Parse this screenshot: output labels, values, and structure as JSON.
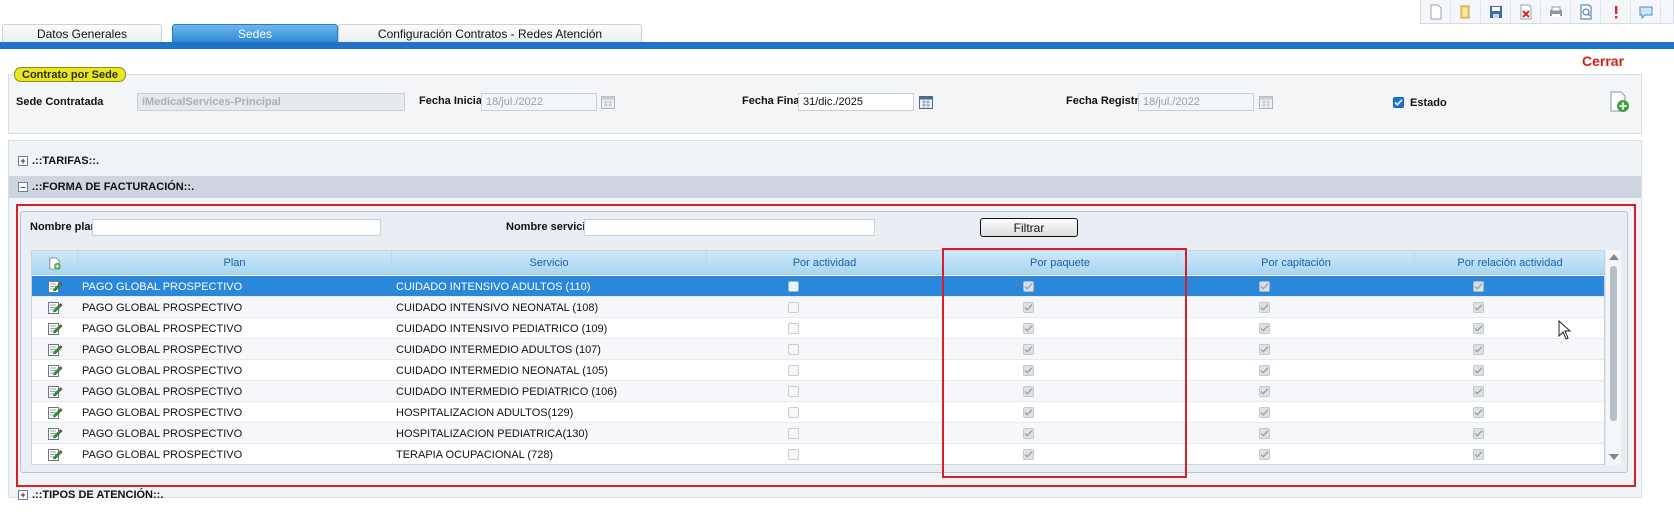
{
  "toolbar": {
    "icons": [
      "new-document-icon",
      "open-folder-icon",
      "save-icon",
      "delete-icon",
      "print-icon",
      "search-document-icon",
      "alert-icon",
      "chat-icon"
    ]
  },
  "tabs": [
    {
      "label": "Datos Generales",
      "active": false
    },
    {
      "label": "Sedes",
      "active": true
    },
    {
      "label": "Configuración Contratos - Redes Atención",
      "active": false
    }
  ],
  "cerrar": "Cerrar",
  "contrato": {
    "badge": "Contrato por Sede",
    "sede_label": "Sede Contratada",
    "sede_value": "iMedicalServices-Principal",
    "fecha_inicial_label": "Fecha Inicial",
    "fecha_inicial_value": "18/jul./2022",
    "fecha_final_label": "Fecha Final",
    "fecha_final_value": "31/dic./2025",
    "fecha_registro_label": "Fecha Registro",
    "fecha_registro_value": "18/jul./2022",
    "estado_label": "Estado",
    "estado_checked": true
  },
  "sections": {
    "tarifas": ".::TARIFAS::.",
    "forma_facturacion": ".::FORMA DE FACTURACIÓN::.",
    "tipos_atencion": ".::TIPOS DE ATENCIÓN::."
  },
  "filters": {
    "nombre_plan_label": "Nombre plan",
    "nombre_plan_value": "",
    "nombre_servicio_label": "Nombre servicio",
    "nombre_servicio_value": "",
    "filtrar_label": "Filtrar"
  },
  "grid": {
    "columns": [
      "Plan",
      "Servicio",
      "Por actividad",
      "Por paquete",
      "Por capitación",
      "Por relación actividad"
    ],
    "rows": [
      {
        "plan": "PAGO GLOBAL PROSPECTIVO",
        "servicio": "CUIDADO INTENSIVO ADULTOS (110)",
        "por_actividad": false,
        "por_paquete": true,
        "por_capitacion": true,
        "por_relacion": true,
        "selected": true
      },
      {
        "plan": "PAGO GLOBAL PROSPECTIVO",
        "servicio": "CUIDADO INTENSIVO NEONATAL (108)",
        "por_actividad": false,
        "por_paquete": true,
        "por_capitacion": true,
        "por_relacion": true,
        "selected": false
      },
      {
        "plan": "PAGO GLOBAL PROSPECTIVO",
        "servicio": "CUIDADO INTENSIVO PEDIATRICO (109)",
        "por_actividad": false,
        "por_paquete": true,
        "por_capitacion": true,
        "por_relacion": true,
        "selected": false
      },
      {
        "plan": "PAGO GLOBAL PROSPECTIVO",
        "servicio": "CUIDADO INTERMEDIO ADULTOS (107)",
        "por_actividad": false,
        "por_paquete": true,
        "por_capitacion": true,
        "por_relacion": true,
        "selected": false
      },
      {
        "plan": "PAGO GLOBAL PROSPECTIVO",
        "servicio": "CUIDADO INTERMEDIO NEONATAL (105)",
        "por_actividad": false,
        "por_paquete": true,
        "por_capitacion": true,
        "por_relacion": true,
        "selected": false
      },
      {
        "plan": "PAGO GLOBAL PROSPECTIVO",
        "servicio": "CUIDADO INTERMEDIO PEDIATRICO (106)",
        "por_actividad": false,
        "por_paquete": true,
        "por_capitacion": true,
        "por_relacion": true,
        "selected": false
      },
      {
        "plan": "PAGO GLOBAL PROSPECTIVO",
        "servicio": "HOSPITALIZACION ADULTOS(129)",
        "por_actividad": false,
        "por_paquete": true,
        "por_capitacion": true,
        "por_relacion": true,
        "selected": false
      },
      {
        "plan": "PAGO GLOBAL PROSPECTIVO",
        "servicio": "HOSPITALIZACION PEDIATRICA(130)",
        "por_actividad": false,
        "por_paquete": true,
        "por_capitacion": true,
        "por_relacion": true,
        "selected": false
      },
      {
        "plan": "PAGO GLOBAL PROSPECTIVO",
        "servicio": "TERAPIA OCUPACIONAL (728)",
        "por_actividad": false,
        "por_paquete": true,
        "por_capitacion": true,
        "por_relacion": true,
        "selected": false
      }
    ]
  },
  "colors": {
    "tab_active": "#2a86d4",
    "tabbar": "#1f73c9",
    "selected_row": "#2a87d9",
    "highlight_outline": "#d62028",
    "cerrar": "#d21f12",
    "badge": "#e9e81e"
  }
}
